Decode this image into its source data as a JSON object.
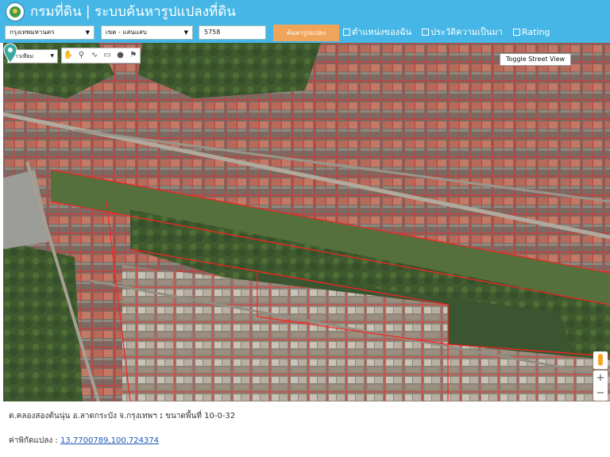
{
  "header": {
    "title": "กรมที่ดิน | ระบบค้นหารูปแปลงที่ดิน",
    "province_select": "กรุงเทพมหานคร",
    "district_select": "เขต - แสนแสบ",
    "parcel_input": "5758",
    "search_button": "ค้นหารูปแปลง",
    "checkbox_my_location": "ตำแหน่งของฉัน",
    "checkbox_history": "ประวัติความเป็นมา",
    "checkbox_rating": "Rating"
  },
  "map": {
    "map_type_select": "ดาวเทียม",
    "street_view_button": "Toggle Street View",
    "zoom_in": "+",
    "zoom_out": "−",
    "tools": [
      "✋",
      "⚲",
      "∿",
      "▭",
      "●",
      "⚑"
    ]
  },
  "info": {
    "location_text": "ต.คลองสองต้นนุ่น อ.ลาดกระบัง จ.กรุงเทพฯ",
    "separator": ":",
    "area_label": "ขนาดพื้นที่",
    "area_value": "10-0-32",
    "coord_label": "ค่าพิกัดแปลง :",
    "coord_value": "13.7700789,100.724374"
  },
  "colors": {
    "header_bg": "#45b6e6",
    "search_button_bg": "#f0a45a",
    "parcel_line": "#ff2020",
    "pin": "#3aa9a0",
    "link": "#1a57b5"
  }
}
